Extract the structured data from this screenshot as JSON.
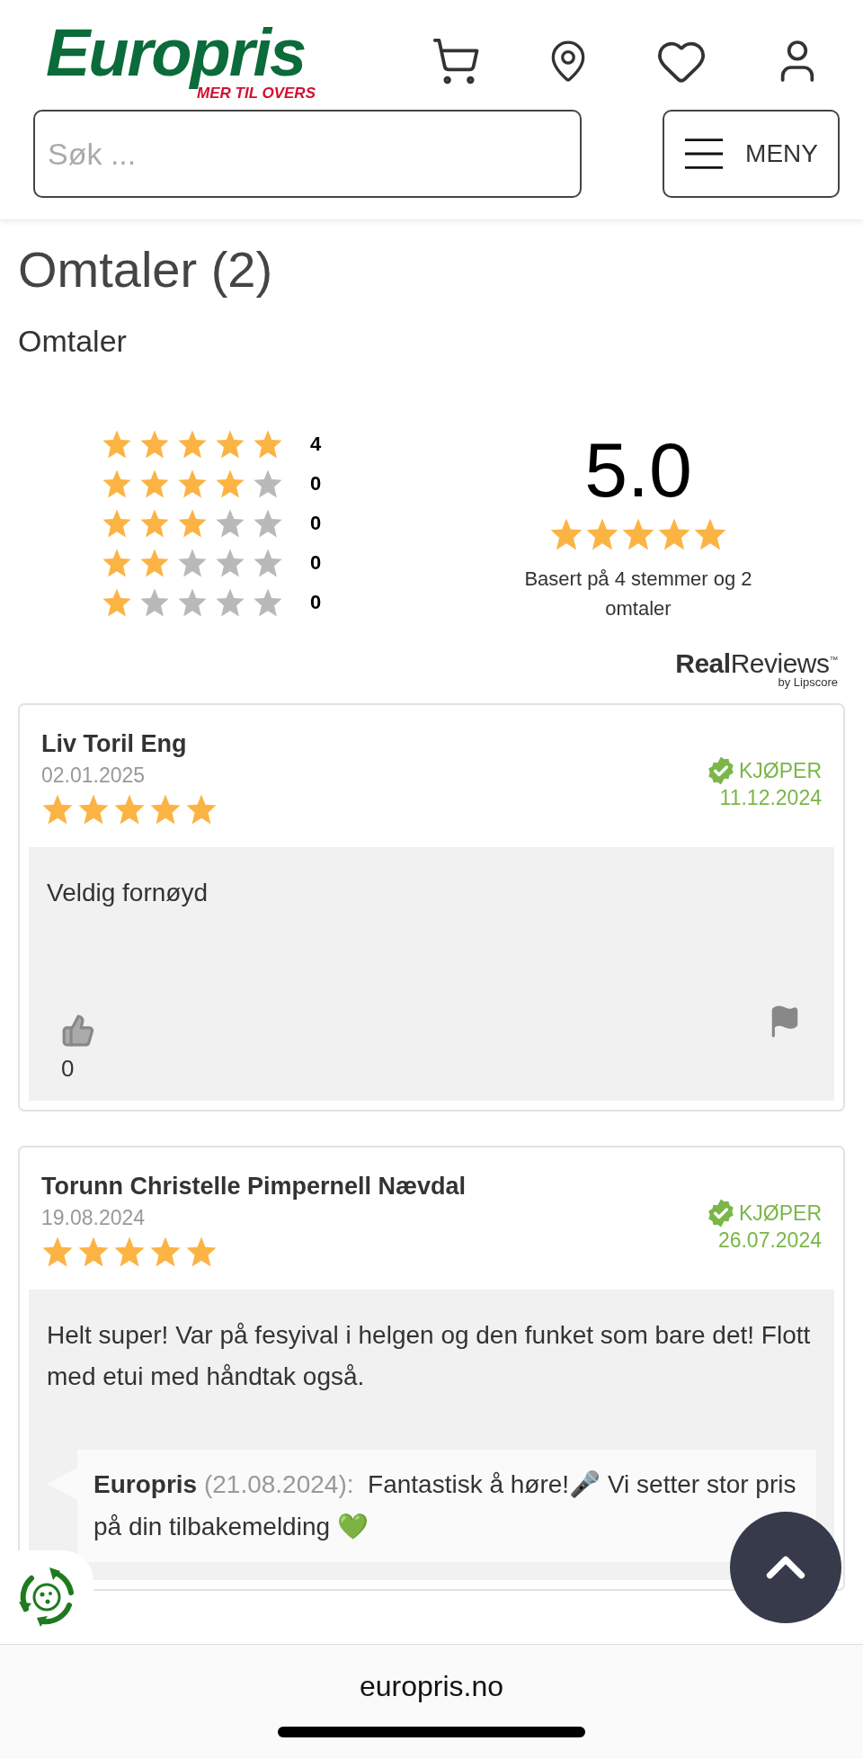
{
  "header": {
    "logo": {
      "wordmark": "Europris",
      "tagline": "MER TIL OVERS"
    },
    "search": {
      "placeholder": "Søk ..."
    },
    "menu_button": "MENY"
  },
  "reviews_section": {
    "title": "Omtaler (2)",
    "subtitle": "Omtaler",
    "distribution": [
      {
        "stars": 5,
        "count": "4"
      },
      {
        "stars": 4,
        "count": "0"
      },
      {
        "stars": 3,
        "count": "0"
      },
      {
        "stars": 2,
        "count": "0"
      },
      {
        "stars": 1,
        "count": "0"
      }
    ],
    "average": {
      "value": "5.0",
      "stars": 5
    },
    "summary": "Basert på 4 stemmer og 2 omtaler",
    "provider": {
      "name": "**Real**Reviews",
      "trademark": "™",
      "byline": "by Lipscore"
    }
  },
  "reviews": [
    {
      "author": "Liv Toril Eng",
      "date": "02.01.2025",
      "stars": 5,
      "buyer_label": "KJØPER",
      "purchase_date": "11.12.2024",
      "text": "Veldig fornøyd",
      "likes": "0"
    },
    {
      "author": "Torunn Christelle Pimpernell Nævdal",
      "date": "19.08.2024",
      "stars": 5,
      "buyer_label": "KJØPER",
      "purchase_date": "26.07.2024",
      "text": "Helt super! Var på fesyival i helgen og den funket som bare det! Flott med etui med håndtak også.",
      "reply": {
        "author": "Europris",
        "date": "(21.08.2024):",
        "text": "Fantastisk å høre!🎤 Vi setter stor pris på din tilbakemelding 💚"
      }
    }
  ],
  "browser_bar": {
    "url": "europris.no"
  }
}
